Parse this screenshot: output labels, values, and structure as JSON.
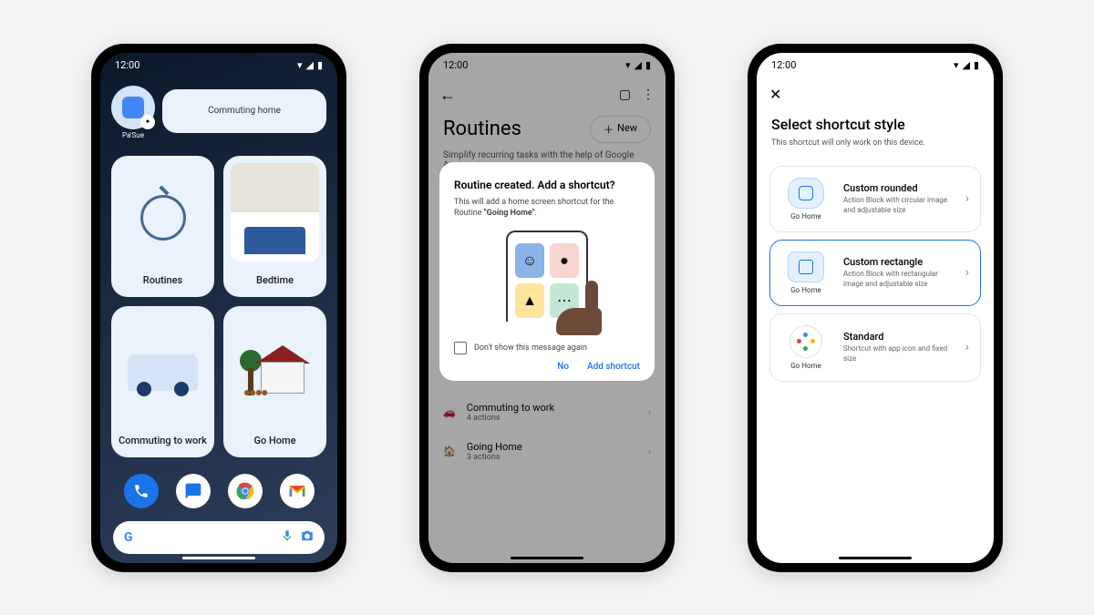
{
  "status": {
    "time": "12:00"
  },
  "phone1": {
    "folder_label": "Pa'Sue",
    "commuting_home": "Commuting home",
    "widgets": {
      "routines": "Routines",
      "bedtime": "Bedtime",
      "commuting_to_work": "Commuting to work",
      "go_home": "Go Home"
    }
  },
  "phone2": {
    "back": "←",
    "title": "Routines",
    "new_label": "New",
    "subtitle": "Simplify recurring tasks with the help of Google Assistant.",
    "dialog": {
      "title": "Routine created. Add a shortcut?",
      "text_prefix": "This will add a home screen shortcut for the Routine ",
      "routine_name": "\"Going Home\"",
      "text_suffix": ".",
      "checkbox_label": "Don't show this message again",
      "no": "No",
      "add": "Add shortcut"
    },
    "rows": [
      {
        "title": "Commuting to work",
        "sub": "4 actions"
      },
      {
        "title": "Going Home",
        "sub": "3 actions"
      }
    ]
  },
  "phone3": {
    "close": "✕",
    "title": "Select shortcut style",
    "subtitle": "This shortcut will only work on this device.",
    "preview_label": "Go Home",
    "options": [
      {
        "title": "Custom rounded",
        "desc": "Action Block with circular image and adjustable size"
      },
      {
        "title": "Custom rectangle",
        "desc": "Action Block with rectangular image and adjustable size"
      },
      {
        "title": "Standard",
        "desc": "Shortcut with app icon and fixed size"
      }
    ]
  }
}
